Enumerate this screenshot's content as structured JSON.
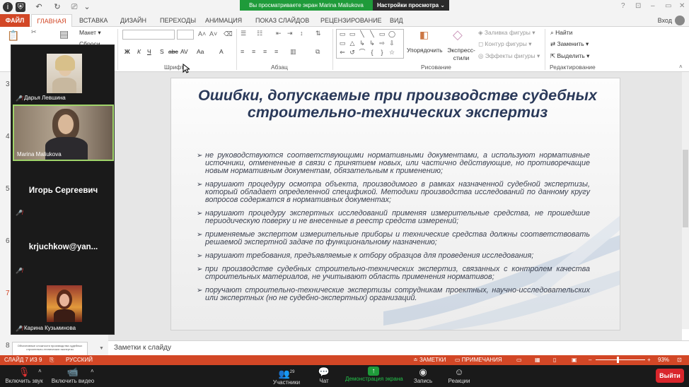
{
  "zoom_banner": {
    "message": "Вы просматриваете экран Marina Maliukova",
    "options": "Настройки просмотра ⌄"
  },
  "tabs": [
    {
      "label": "ФАЙЛ"
    },
    {
      "label": "ГЛАВНАЯ"
    },
    {
      "label": "ВСТАВКА"
    },
    {
      "label": "ДИЗАЙН"
    },
    {
      "label": "ПЕРЕХОДЫ"
    },
    {
      "label": "АНИМАЦИЯ"
    },
    {
      "label": "ПОКАЗ СЛАЙДОВ"
    },
    {
      "label": "РЕЦЕНЗИРОВАНИЕ"
    },
    {
      "label": "ВИД"
    }
  ],
  "signin": "Вход",
  "ribbon": {
    "layout": "Макет",
    "reset": "Сброси",
    "font_group": "Шрифт",
    "paragraph_group": "Абзац",
    "drawing_group": "Рисование",
    "editing_group": "Редактирование",
    "arrange": "Упорядочить",
    "quick_styles": "Экспресс-стили",
    "shape_fill": "Заливка фигуры",
    "shape_outline": "Контур фигуры",
    "shape_effects": "Эффекты фигуры",
    "find": "Найти",
    "replace": "Заменить",
    "select": "Выделить",
    "bold": "Ж",
    "italic": "К",
    "underline": "Ч",
    "strike": "S",
    "abc": "abc",
    "av": "AV",
    "aa": "Aa",
    "a": "A"
  },
  "thumbnails": {
    "numbers": [
      "3",
      "4",
      "5",
      "6",
      "7",
      "8"
    ],
    "thumb8_text": "Объективные сложности производства судебных строительно-технических экспертиз"
  },
  "participants": [
    {
      "name": "Дарья Левшина"
    },
    {
      "name": "Marina Maliukova"
    },
    {
      "name": "Игорь Сергеевич"
    },
    {
      "name": "krjuchkow@yan..."
    },
    {
      "name": "Карина Кузьминова"
    }
  ],
  "slide": {
    "title": "Ошибки, допускаемые при производстве судебных строительно-технических экспертиз",
    "bullets": [
      "не руководствуются соответствующими нормативными документами, а используют нормативные источники, отмененные в связи с принятием новых, или частично действующие, но противоречащие новым нормативным документам, обязательным к применению;",
      "нарушают процедуру осмотра объекта, производимого в рамках назначенной судебной экспертизы, который обладает определенной спецификой. Методики производства исследований по данному кругу вопросов содержатся в нормативных документах;",
      "нарушают процедуру экспертных исследований применяя измерительные средства, не прошедшие периодическую поверку и не внесенные в реестр средств измерений;",
      "применяемые экспертом измерительные приборы и технические средства должны соответствовать решаемой экспертной задаче по функциональному назначению;",
      "нарушают требования, предъявляемые к отбору образцов для проведения исследования;",
      "при производстве судебных строительно-технических экспертиз, связанных с контролем качества строительных материалов, не учитывают область применения нормативов;",
      "поручают строительно-технические экспертизы сотрудникам проектных, научно-исследовательских или экспертных (но не судебно-экспертных) организаций."
    ]
  },
  "notes_label": "Заметки к слайду",
  "statusbar": {
    "slide_of": "СЛАЙД 7 ИЗ 9",
    "language": "РУССКИЙ",
    "notes": "ЗАМЕТКИ",
    "comments": "ПРИМЕЧАНИЯ",
    "zoom": "93%"
  },
  "zoom_toolbar": {
    "unmute": "Включить звук",
    "start_video": "Включить видео",
    "participants": "Участники",
    "participants_count": "29",
    "chat": "Чат",
    "share": "Демонстрация экрана",
    "record": "Запись",
    "reactions": "Реакции",
    "leave": "Выйти"
  }
}
